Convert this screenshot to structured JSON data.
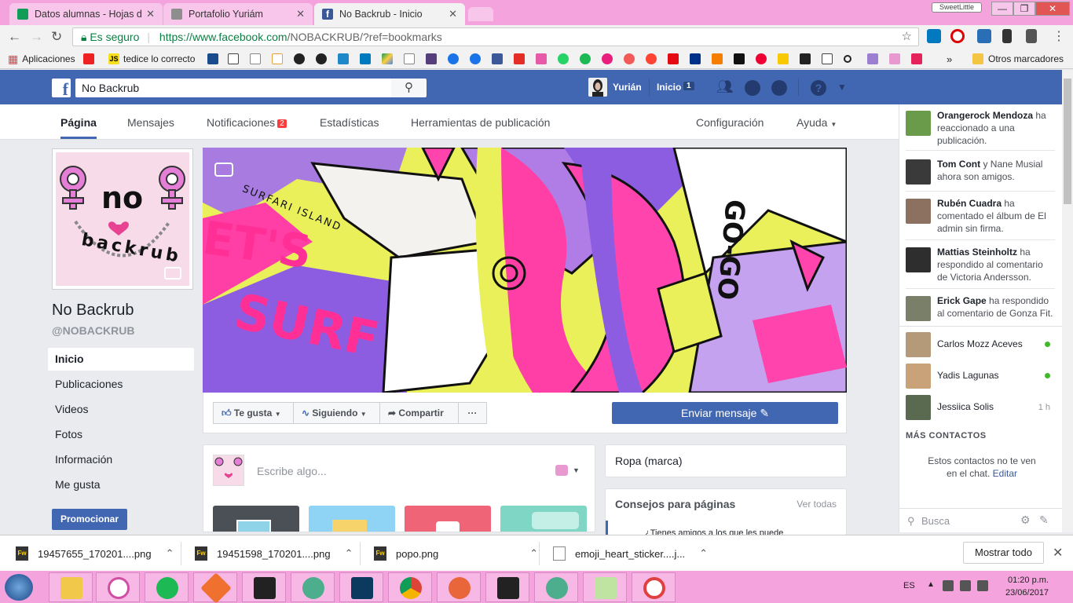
{
  "browser": {
    "tabs": [
      {
        "title": "Datos alumnas - Hojas d",
        "icon": "sheets-icon",
        "color": "#0f9d58",
        "active": false
      },
      {
        "title": "Portafolio Yuriám",
        "icon": "page-icon",
        "color": "#8e8e8e",
        "active": false
      },
      {
        "title": "No Backrub - Inicio",
        "icon": "facebook-icon",
        "color": "#3b5998",
        "active": true
      }
    ],
    "profile_badge": "SweetLittle",
    "security_label": "Es seguro",
    "url_host": "https://www.facebook.com",
    "url_path": "/NOBACKRUB/?ref=bookmarks",
    "bookmarks": [
      "Aplicaciones",
      "tedice lo correcto"
    ],
    "other_bookmarks": "Otros marcadores"
  },
  "facebook": {
    "search_value": "No Backrub",
    "user_name": "Yurián",
    "home_label": "Inicio",
    "home_count": "1",
    "page_tabs": [
      "Página",
      "Mensajes",
      "Notificaciones",
      "Estadísticas",
      "Herramientas de publicación"
    ],
    "notifications_count": "2",
    "settings_label": "Configuración",
    "help_label": "Ayuda"
  },
  "page": {
    "name": "No Backrub",
    "handle": "@NOBACKRUB",
    "left_nav": [
      "Inicio",
      "Publicaciones",
      "Videos",
      "Fotos",
      "Información",
      "Me gusta"
    ],
    "promote_label": "Promocionar",
    "profile_logo_top": "no",
    "profile_logo_bottom": "backrub",
    "cover_text": {
      "lets": "ET'S",
      "surf": "SURF",
      "surfari": "SURFARI ISLAND",
      "go": "GO-GO"
    },
    "actions": {
      "like": "Te gusta",
      "following": "Siguiendo",
      "share": "Compartir",
      "more": "···",
      "message": "Enviar mensaje"
    },
    "composer_placeholder": "Escribe algo...",
    "category": "Ropa (marca)",
    "tips_title": "Consejos para páginas",
    "tips_link": "Ver todas",
    "tips_preview": "¿Tienes amigos a los que les puede"
  },
  "chat": {
    "activity": [
      {
        "name": "Orangerock Mendoza",
        "text": " ha reaccionado a una publicación."
      },
      {
        "name": "Tom Cont",
        "text": " y Nane Musial ahora son amigos."
      },
      {
        "name": "Rubén Cuadra",
        "text": " ha comentado el álbum de El admin sin firma."
      },
      {
        "name": "Mattias Steinholtz",
        "text": " ha respondido al comentario de Victoria Andersson."
      },
      {
        "name": "Erick Gape",
        "text": " ha respondido al comentario de Gonza Fit."
      }
    ],
    "contacts": [
      {
        "name": "Carlos Mozz Aceves",
        "status": "online"
      },
      {
        "name": "Yadis Lagunas",
        "status": "online"
      },
      {
        "name": "Jessiica Solis",
        "status": "1 h"
      }
    ],
    "more_contacts_title": "MÁS CONTACTOS",
    "more_contacts_text": "Estos contactos no te ven en el chat.",
    "more_contacts_link": "Editar",
    "search_placeholder": "Busca"
  },
  "downloads": {
    "items": [
      "19457655_170201....png",
      "19451598_170201....png",
      "popo.png",
      "emoji_heart_sticker....j..."
    ],
    "show_all": "Mostrar todo"
  },
  "taskbar": {
    "language": "ES",
    "time": "01:20 p.m.",
    "date": "23/06/2017"
  },
  "colors": {
    "facebook_blue": "#4267b2",
    "desktop_pink": "#f5a3dd",
    "notification_red": "#fa3e3e",
    "online_green": "#42b72a"
  }
}
